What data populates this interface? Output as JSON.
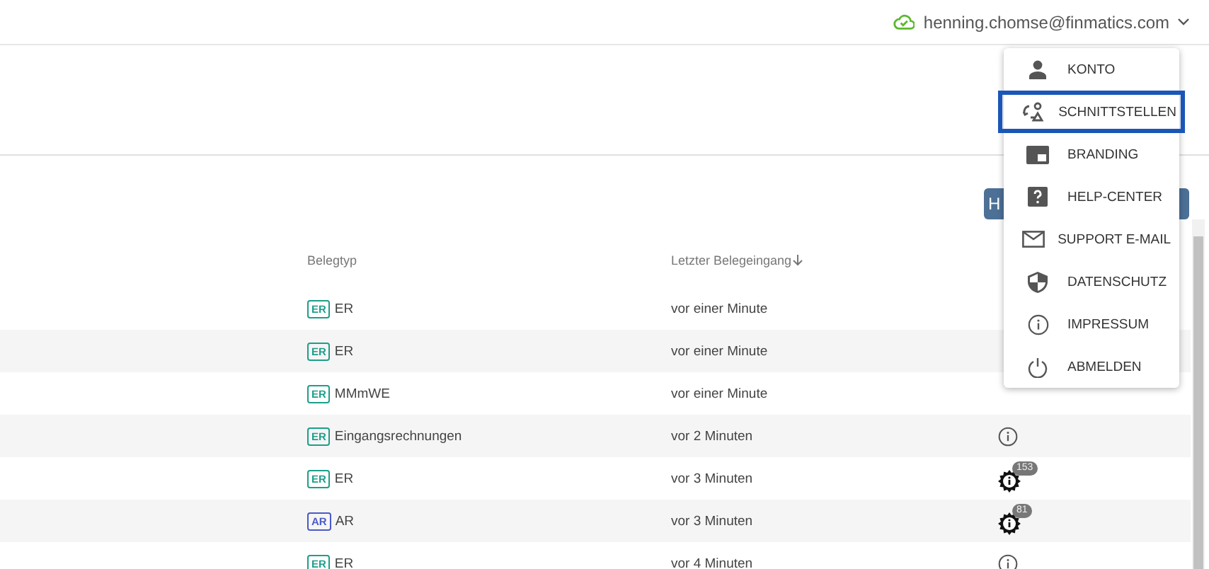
{
  "header": {
    "user": "henning.chomse@finmatics.com"
  },
  "toolbar": {
    "button": "H"
  },
  "table": {
    "columns": [
      "Belegtyp",
      "Letzter Belegeingang"
    ],
    "rows": [
      {
        "tag": "ER",
        "type": "ER",
        "time": "vor einer Minute",
        "status": {
          "kind": "hidden"
        }
      },
      {
        "tag": "ER",
        "type": "ER",
        "time": "vor einer Minute",
        "status": {
          "kind": "hidden"
        }
      },
      {
        "tag": "ER",
        "type": "MMmWE",
        "time": "vor einer Minute",
        "status": {
          "kind": "hidden"
        }
      },
      {
        "tag": "ER",
        "type": "Eingangsrechnungen",
        "time": "vor 2 Minuten",
        "status": {
          "kind": "info"
        }
      },
      {
        "tag": "ER",
        "type": "ER",
        "time": "vor 3 Minuten",
        "status": {
          "kind": "gear",
          "count": "153"
        }
      },
      {
        "tag": "AR",
        "type": "AR",
        "time": "vor 3 Minuten",
        "status": {
          "kind": "gear",
          "count": "81"
        }
      },
      {
        "tag": "ER",
        "type": "ER",
        "time": "vor 4 Minuten",
        "status": {
          "kind": "info"
        }
      }
    ]
  },
  "menu": {
    "items": [
      {
        "kind": "person",
        "label": "KONTO",
        "selected": false
      },
      {
        "kind": "interface",
        "label": "SCHNITTSTELLEN",
        "selected": true
      },
      {
        "kind": "branding",
        "label": "BRANDING",
        "selected": false
      },
      {
        "kind": "help",
        "label": "HELP-CENTER",
        "selected": false
      },
      {
        "kind": "mail",
        "label": "SUPPORT E-MAIL",
        "selected": false
      },
      {
        "kind": "shield",
        "label": "DATENSCHUTZ",
        "selected": false
      },
      {
        "kind": "info",
        "label": "IMPRESSUM",
        "selected": false
      },
      {
        "kind": "power",
        "label": "ABMELDEN",
        "selected": false
      }
    ]
  }
}
